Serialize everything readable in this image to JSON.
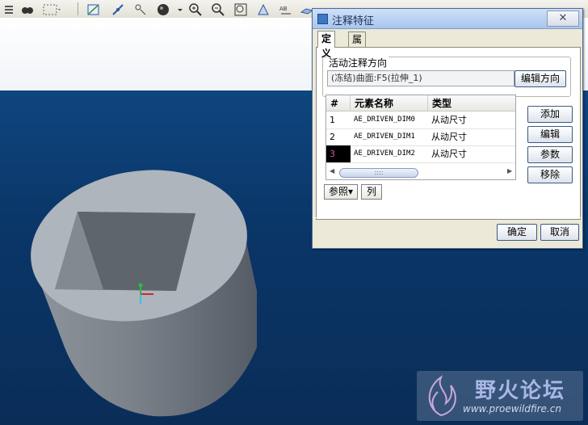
{
  "toolbar": {
    "icons": [
      "datum-display-icon",
      "find-icon",
      "select-box-icon",
      "plane-icon",
      "axis-icon",
      "point-icon",
      "spin-center-icon",
      "shading-icon",
      "zoom-in-icon",
      "zoom-out-icon",
      "refit-icon",
      "orient-icon",
      "annotation-icon",
      "layer-icon"
    ]
  },
  "dialog": {
    "title": "注释特征",
    "close_symbol": "✕",
    "tabs": [
      {
        "label": "定义"
      },
      {
        "label": "属性"
      }
    ],
    "direction": {
      "group_label": "活动注释方向",
      "value": "(冻结)曲面:F5(拉伸_1)",
      "edit_button": "编辑方向"
    },
    "table": {
      "headers": [
        "#",
        "元素名称",
        "类型"
      ],
      "rows": [
        {
          "num": "1",
          "name": "AE_DRIVEN_DIM0",
          "type": "从动尺寸"
        },
        {
          "num": "2",
          "name": "AE_DRIVEN_DIM1",
          "type": "从动尺寸"
        },
        {
          "num": "3",
          "name": "AE_DRIVEN_DIM2",
          "type": "从动尺寸"
        }
      ],
      "scroll_thumb": "::::"
    },
    "side_buttons": {
      "add": "添加",
      "edit": "编辑",
      "params": "参数",
      "remove": "移除"
    },
    "ref_menu": "参照",
    "ref_arrow": "▾",
    "col_button": "列",
    "ok": "确定",
    "cancel": "取消"
  },
  "watermark": {
    "name": "野火论坛",
    "url": "www.proewildfire.cn"
  },
  "colors": {
    "background": "#0b3a6e",
    "model": "#9aa3ac",
    "selected_number": "#cc56a8"
  }
}
